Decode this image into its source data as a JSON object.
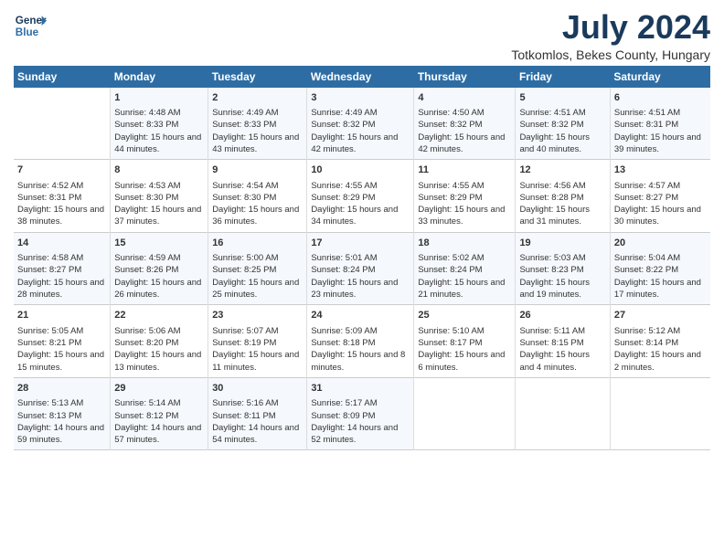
{
  "header": {
    "logo_line1": "General",
    "logo_line2": "Blue",
    "month_year": "July 2024",
    "location": "Totkomlos, Bekes County, Hungary"
  },
  "columns": [
    "Sunday",
    "Monday",
    "Tuesday",
    "Wednesday",
    "Thursday",
    "Friday",
    "Saturday"
  ],
  "weeks": [
    [
      {
        "day": "",
        "sunrise": "",
        "sunset": "",
        "daylight": ""
      },
      {
        "day": "1",
        "sunrise": "Sunrise: 4:48 AM",
        "sunset": "Sunset: 8:33 PM",
        "daylight": "Daylight: 15 hours and 44 minutes."
      },
      {
        "day": "2",
        "sunrise": "Sunrise: 4:49 AM",
        "sunset": "Sunset: 8:33 PM",
        "daylight": "Daylight: 15 hours and 43 minutes."
      },
      {
        "day": "3",
        "sunrise": "Sunrise: 4:49 AM",
        "sunset": "Sunset: 8:32 PM",
        "daylight": "Daylight: 15 hours and 42 minutes."
      },
      {
        "day": "4",
        "sunrise": "Sunrise: 4:50 AM",
        "sunset": "Sunset: 8:32 PM",
        "daylight": "Daylight: 15 hours and 42 minutes."
      },
      {
        "day": "5",
        "sunrise": "Sunrise: 4:51 AM",
        "sunset": "Sunset: 8:32 PM",
        "daylight": "Daylight: 15 hours and 40 minutes."
      },
      {
        "day": "6",
        "sunrise": "Sunrise: 4:51 AM",
        "sunset": "Sunset: 8:31 PM",
        "daylight": "Daylight: 15 hours and 39 minutes."
      }
    ],
    [
      {
        "day": "7",
        "sunrise": "Sunrise: 4:52 AM",
        "sunset": "Sunset: 8:31 PM",
        "daylight": "Daylight: 15 hours and 38 minutes."
      },
      {
        "day": "8",
        "sunrise": "Sunrise: 4:53 AM",
        "sunset": "Sunset: 8:30 PM",
        "daylight": "Daylight: 15 hours and 37 minutes."
      },
      {
        "day": "9",
        "sunrise": "Sunrise: 4:54 AM",
        "sunset": "Sunset: 8:30 PM",
        "daylight": "Daylight: 15 hours and 36 minutes."
      },
      {
        "day": "10",
        "sunrise": "Sunrise: 4:55 AM",
        "sunset": "Sunset: 8:29 PM",
        "daylight": "Daylight: 15 hours and 34 minutes."
      },
      {
        "day": "11",
        "sunrise": "Sunrise: 4:55 AM",
        "sunset": "Sunset: 8:29 PM",
        "daylight": "Daylight: 15 hours and 33 minutes."
      },
      {
        "day": "12",
        "sunrise": "Sunrise: 4:56 AM",
        "sunset": "Sunset: 8:28 PM",
        "daylight": "Daylight: 15 hours and 31 minutes."
      },
      {
        "day": "13",
        "sunrise": "Sunrise: 4:57 AM",
        "sunset": "Sunset: 8:27 PM",
        "daylight": "Daylight: 15 hours and 30 minutes."
      }
    ],
    [
      {
        "day": "14",
        "sunrise": "Sunrise: 4:58 AM",
        "sunset": "Sunset: 8:27 PM",
        "daylight": "Daylight: 15 hours and 28 minutes."
      },
      {
        "day": "15",
        "sunrise": "Sunrise: 4:59 AM",
        "sunset": "Sunset: 8:26 PM",
        "daylight": "Daylight: 15 hours and 26 minutes."
      },
      {
        "day": "16",
        "sunrise": "Sunrise: 5:00 AM",
        "sunset": "Sunset: 8:25 PM",
        "daylight": "Daylight: 15 hours and 25 minutes."
      },
      {
        "day": "17",
        "sunrise": "Sunrise: 5:01 AM",
        "sunset": "Sunset: 8:24 PM",
        "daylight": "Daylight: 15 hours and 23 minutes."
      },
      {
        "day": "18",
        "sunrise": "Sunrise: 5:02 AM",
        "sunset": "Sunset: 8:24 PM",
        "daylight": "Daylight: 15 hours and 21 minutes."
      },
      {
        "day": "19",
        "sunrise": "Sunrise: 5:03 AM",
        "sunset": "Sunset: 8:23 PM",
        "daylight": "Daylight: 15 hours and 19 minutes."
      },
      {
        "day": "20",
        "sunrise": "Sunrise: 5:04 AM",
        "sunset": "Sunset: 8:22 PM",
        "daylight": "Daylight: 15 hours and 17 minutes."
      }
    ],
    [
      {
        "day": "21",
        "sunrise": "Sunrise: 5:05 AM",
        "sunset": "Sunset: 8:21 PM",
        "daylight": "Daylight: 15 hours and 15 minutes."
      },
      {
        "day": "22",
        "sunrise": "Sunrise: 5:06 AM",
        "sunset": "Sunset: 8:20 PM",
        "daylight": "Daylight: 15 hours and 13 minutes."
      },
      {
        "day": "23",
        "sunrise": "Sunrise: 5:07 AM",
        "sunset": "Sunset: 8:19 PM",
        "daylight": "Daylight: 15 hours and 11 minutes."
      },
      {
        "day": "24",
        "sunrise": "Sunrise: 5:09 AM",
        "sunset": "Sunset: 8:18 PM",
        "daylight": "Daylight: 15 hours and 8 minutes."
      },
      {
        "day": "25",
        "sunrise": "Sunrise: 5:10 AM",
        "sunset": "Sunset: 8:17 PM",
        "daylight": "Daylight: 15 hours and 6 minutes."
      },
      {
        "day": "26",
        "sunrise": "Sunrise: 5:11 AM",
        "sunset": "Sunset: 8:15 PM",
        "daylight": "Daylight: 15 hours and 4 minutes."
      },
      {
        "day": "27",
        "sunrise": "Sunrise: 5:12 AM",
        "sunset": "Sunset: 8:14 PM",
        "daylight": "Daylight: 15 hours and 2 minutes."
      }
    ],
    [
      {
        "day": "28",
        "sunrise": "Sunrise: 5:13 AM",
        "sunset": "Sunset: 8:13 PM",
        "daylight": "Daylight: 14 hours and 59 minutes."
      },
      {
        "day": "29",
        "sunrise": "Sunrise: 5:14 AM",
        "sunset": "Sunset: 8:12 PM",
        "daylight": "Daylight: 14 hours and 57 minutes."
      },
      {
        "day": "30",
        "sunrise": "Sunrise: 5:16 AM",
        "sunset": "Sunset: 8:11 PM",
        "daylight": "Daylight: 14 hours and 54 minutes."
      },
      {
        "day": "31",
        "sunrise": "Sunrise: 5:17 AM",
        "sunset": "Sunset: 8:09 PM",
        "daylight": "Daylight: 14 hours and 52 minutes."
      },
      {
        "day": "",
        "sunrise": "",
        "sunset": "",
        "daylight": ""
      },
      {
        "day": "",
        "sunrise": "",
        "sunset": "",
        "daylight": ""
      },
      {
        "day": "",
        "sunrise": "",
        "sunset": "",
        "daylight": ""
      }
    ]
  ]
}
